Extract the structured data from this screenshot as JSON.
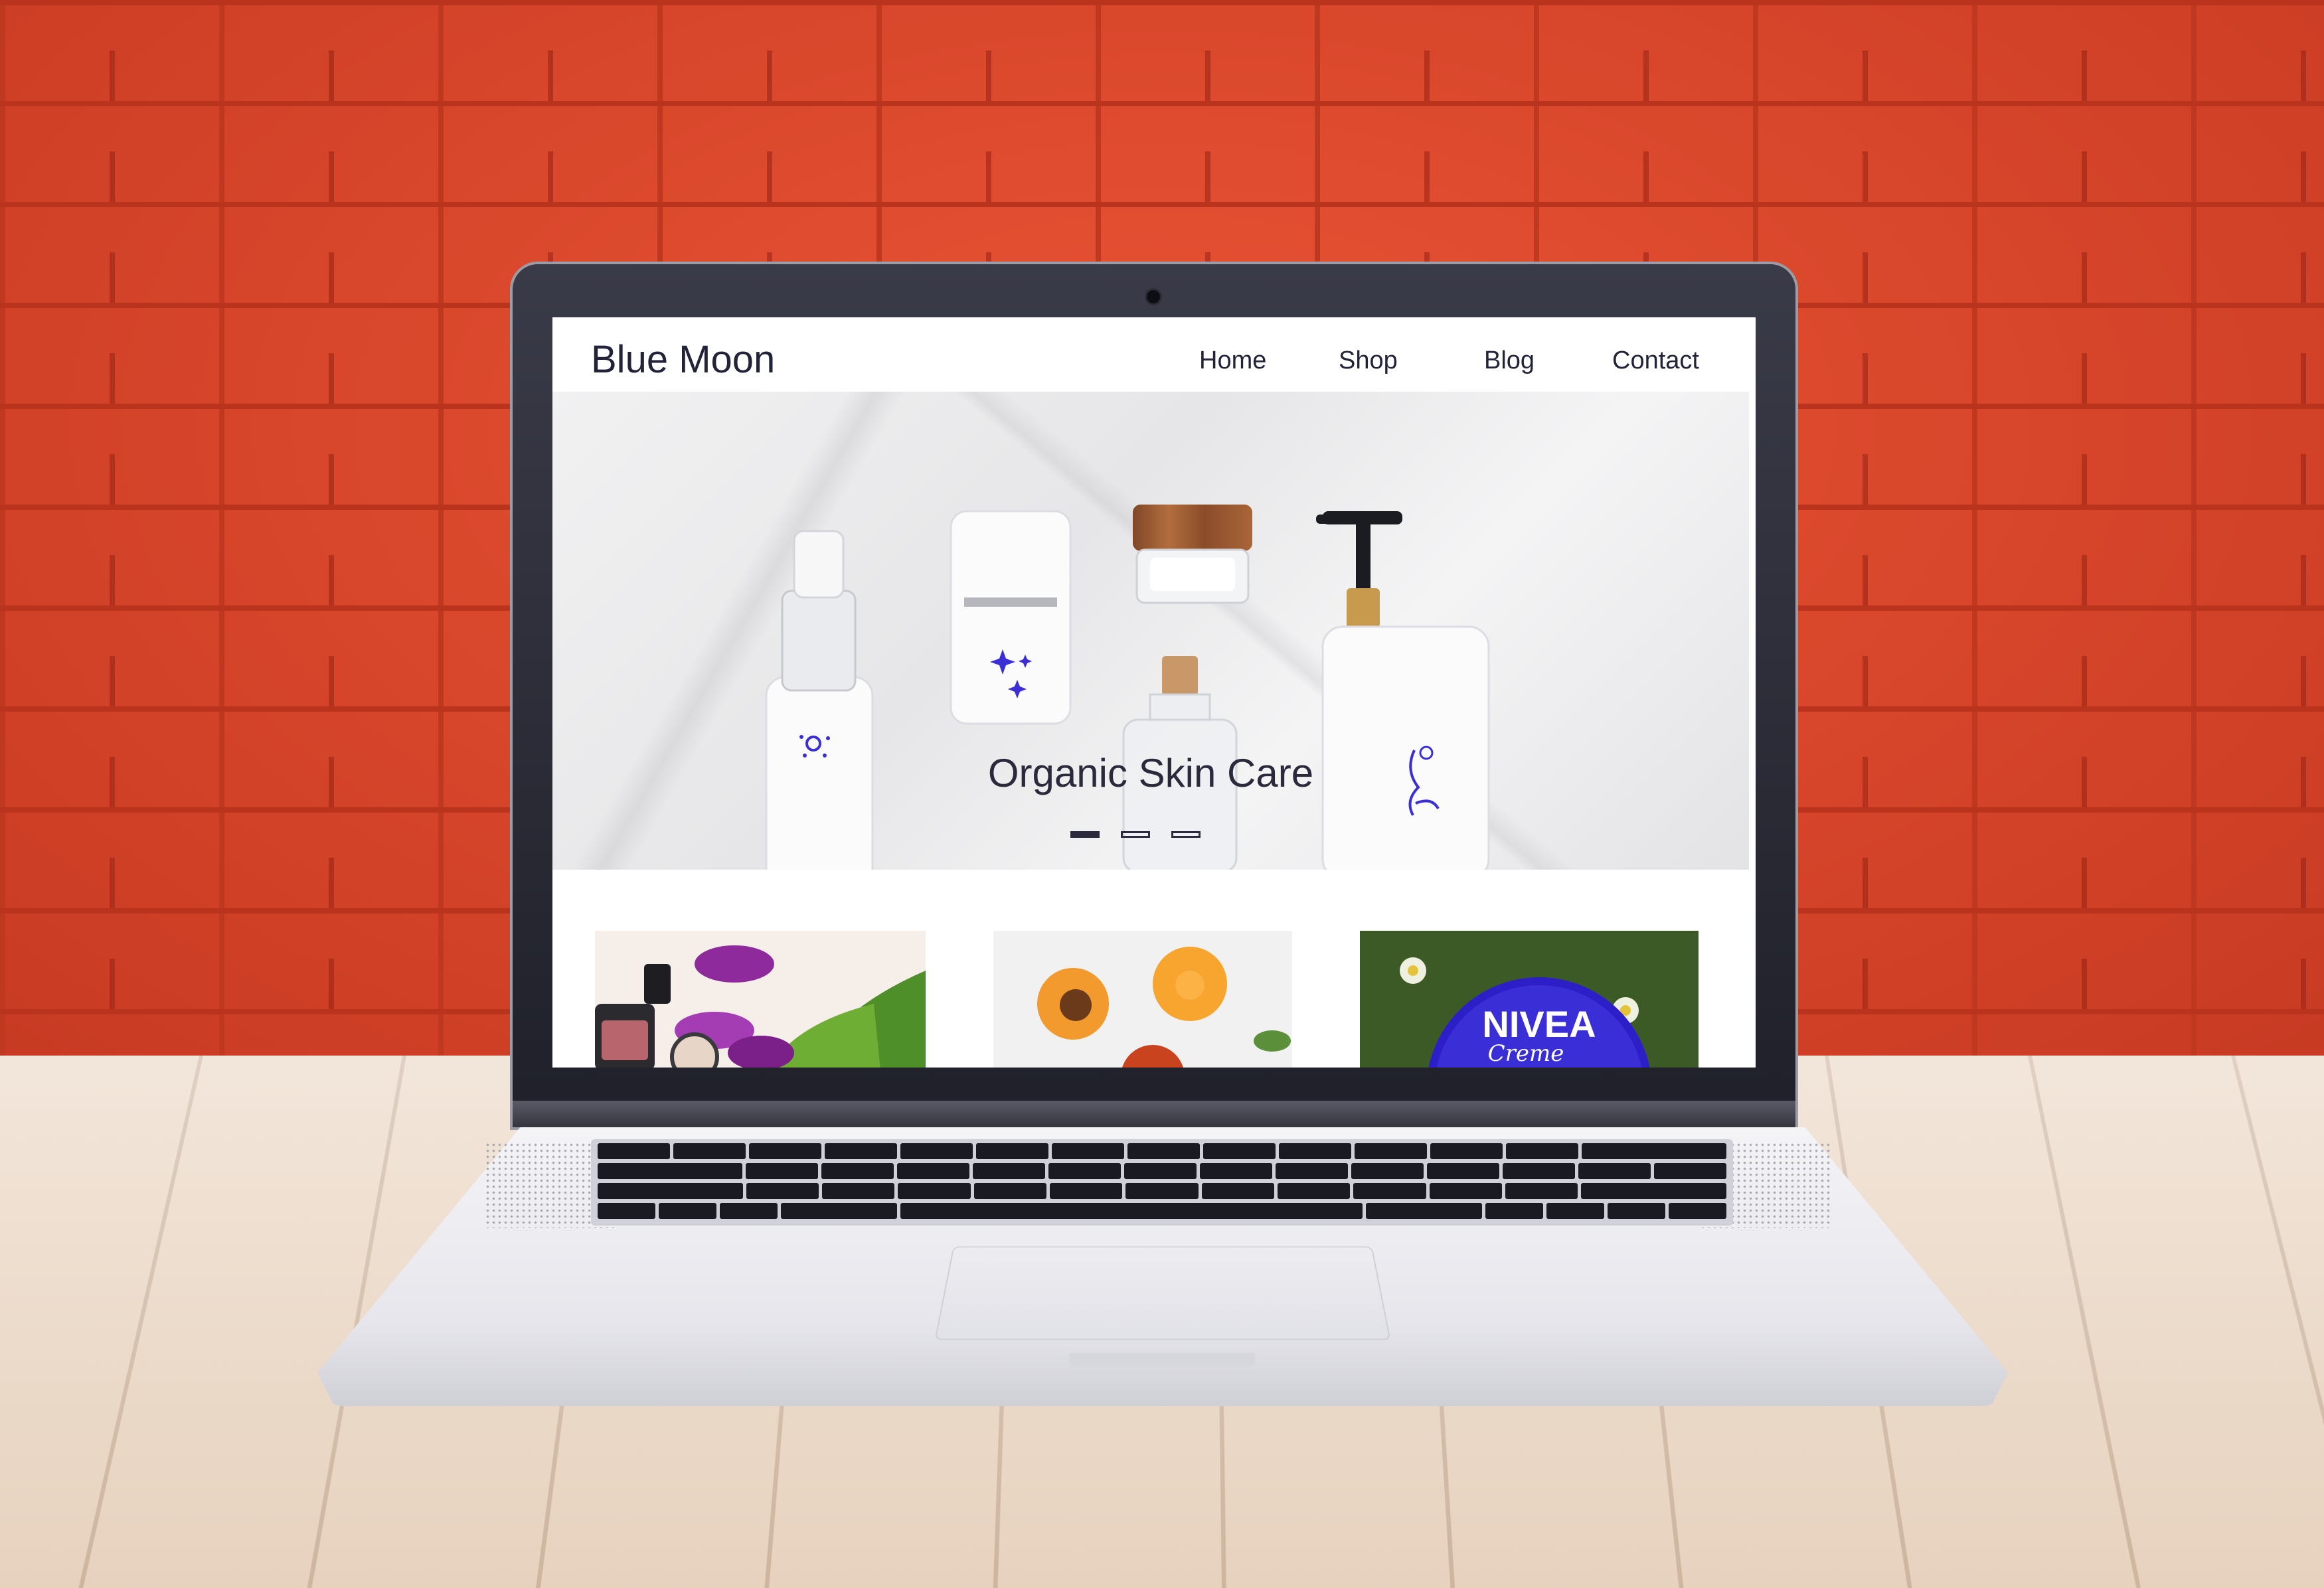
{
  "site": {
    "brand": "Blue Moon",
    "nav": [
      {
        "label": "Home"
      },
      {
        "label": "Shop"
      },
      {
        "label": "Blog"
      },
      {
        "label": "Contact"
      }
    ]
  },
  "hero": {
    "title": "Organic Skin Care",
    "slides": 3,
    "active_slide": 1
  },
  "products": [
    {
      "image": "tulips-and-makeup"
    },
    {
      "image": "apricots"
    },
    {
      "image": "nivea-tin",
      "printed_text": [
        "NIVEA",
        "Creme"
      ]
    }
  ],
  "colors": {
    "wall": "#e2472b",
    "accent_blue": "#3a2fd6",
    "text": "#22233a"
  }
}
